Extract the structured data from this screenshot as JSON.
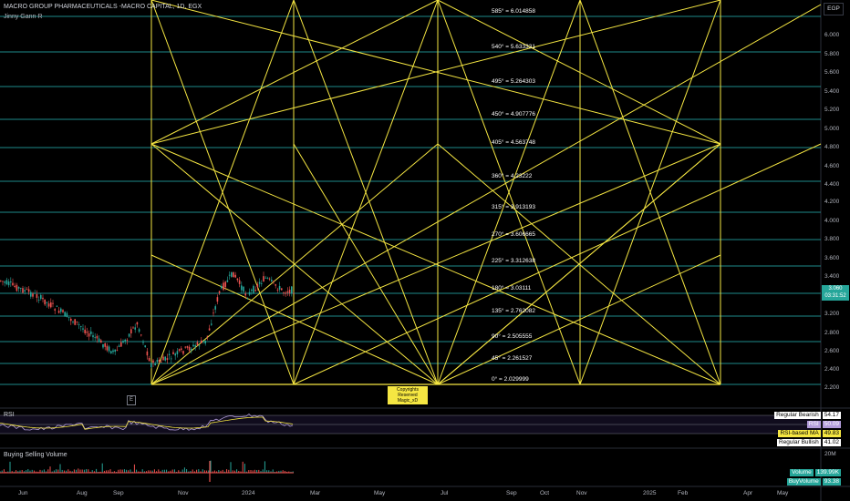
{
  "header": {
    "title": "MACRO GROUP PHARMACEUTICALS -MACRO CAPITAL, 1D, EGX",
    "indicator": "Jinny Gann R"
  },
  "price_axis": {
    "currency": "EGP",
    "ticks": [
      "6.000",
      "5.800",
      "5.600",
      "5.400",
      "5.200",
      "5.000",
      "4.800",
      "4.600",
      "4.400",
      "4.200",
      "4.000",
      "3.800",
      "3.600",
      "3.400",
      "3.200",
      "2.800",
      "2.600",
      "2.400",
      "2.200",
      "2.000"
    ],
    "last_price": "3.060",
    "countdown": "03:31:52"
  },
  "gann_levels": [
    {
      "label": "585° = 6.014858"
    },
    {
      "label": "540° = 5.633331"
    },
    {
      "label": "495° = 5.264303"
    },
    {
      "label": "450° = 4.907776"
    },
    {
      "label": "405° = 4.563748"
    },
    {
      "label": "360° = 4.23222"
    },
    {
      "label": "315° = 3.913193"
    },
    {
      "label": "270° = 3.606665"
    },
    {
      "label": "225° = 3.312638"
    },
    {
      "label": "180° = 3.03111"
    },
    {
      "label": "135° = 2.762082"
    },
    {
      "label": "90° = 2.505555"
    },
    {
      "label": "45° = 2.261527"
    },
    {
      "label": "0° = 2.029999"
    }
  ],
  "copyright": {
    "line1": "Copyrights Reserved",
    "line2": "Magic_xD"
  },
  "e_button": "E",
  "rsi": {
    "label": "RSI",
    "legend": [
      {
        "name": "Regular Bearish",
        "value": "54.17",
        "color": "#ffffff"
      },
      {
        "name": "RSI",
        "value": "50.09",
        "color": "#b39ddb"
      },
      {
        "name": "RSI-based MA",
        "value": "49.83",
        "color": "#f5e642"
      },
      {
        "name": "Regular Bullish",
        "value": "41.02",
        "color": "#ffffff"
      }
    ]
  },
  "volume": {
    "label": "Buying Selling Volume",
    "axis_top": "20M",
    "legend": [
      {
        "name": "Volume",
        "value": "139.99K",
        "color": "#26a69a"
      },
      {
        "name": "BuyVolume",
        "value": "93.38",
        "color": "#26a69a"
      }
    ]
  },
  "time_axis": [
    "Jun",
    "Aug",
    "Sep",
    "Nov",
    "2024",
    "Mar",
    "May",
    "Jul",
    "Sep",
    "Oct",
    "Nov",
    "2025",
    "Feb",
    "Apr",
    "May"
  ],
  "colors": {
    "gann": "#f5e642",
    "level": "#1e8a8a",
    "up": "#26a69a",
    "down": "#ef5350"
  }
}
